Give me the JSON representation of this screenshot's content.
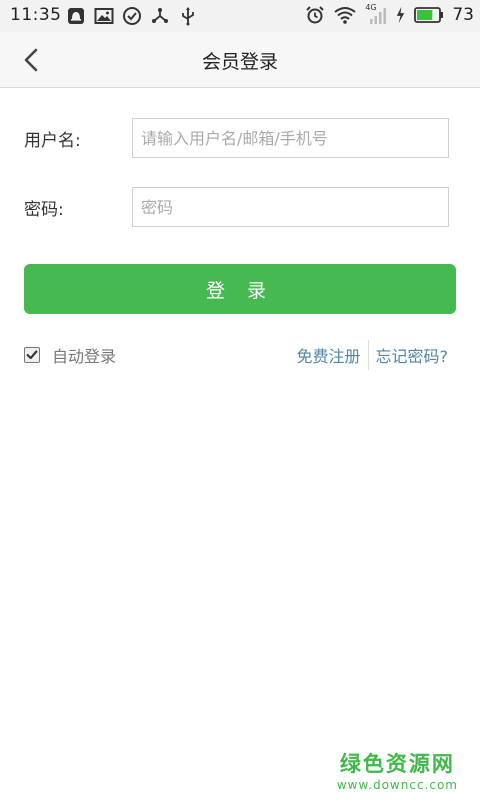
{
  "status_bar": {
    "time": "11:35",
    "left_icons": [
      "notification-icon",
      "image-icon",
      "check-circle-icon",
      "share-icon",
      "usb-icon"
    ],
    "right_icons": [
      "alarm-icon",
      "wifi-icon",
      "signal-icon",
      "charging-icon",
      "battery-icon"
    ],
    "network": "4G",
    "battery_level": 73,
    "battery_text": "73"
  },
  "header": {
    "back_icon": "chevron-left-icon",
    "title": "会员登录"
  },
  "form": {
    "username_label": "用户名:",
    "username_placeholder": "请输入用户名/邮箱/手机号",
    "username_value": "",
    "password_label": "密码:",
    "password_placeholder": "密码",
    "password_value": ""
  },
  "login_button": "登 录",
  "auto_login": {
    "label": "自动登录",
    "checked": true
  },
  "links": {
    "register": "免费注册",
    "forgot": "忘记密码?"
  },
  "watermark": {
    "main": "绿色资源网",
    "sub": "www.downcc.com"
  },
  "colors": {
    "accent_green": "#46b950",
    "link_blue": "#4f87a6",
    "watermark_green": "#41b84a"
  }
}
